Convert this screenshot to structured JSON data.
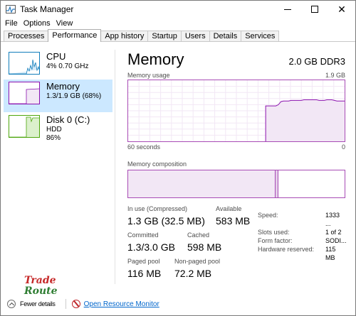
{
  "window": {
    "title": "Task Manager"
  },
  "menu": [
    "File",
    "Options",
    "View"
  ],
  "tabs": [
    "Processes",
    "Performance",
    "App history",
    "Startup",
    "Users",
    "Details",
    "Services"
  ],
  "active_tab": "Performance",
  "sidebar": [
    {
      "name": "CPU",
      "sub1": "4%  0.70 GHz",
      "sub2": "",
      "color": "#117dbb"
    },
    {
      "name": "Memory",
      "sub1": "1.3/1.9 GB (68%)",
      "sub2": "",
      "color": "#8b12ae"
    },
    {
      "name": "Disk 0 (C:)",
      "sub1": "HDD",
      "sub2": "86%",
      "color": "#4da60c"
    }
  ],
  "main": {
    "title": "Memory",
    "spec": "2.0 GB DDR3",
    "usage_label": "Memory usage",
    "usage_max": "1.9 GB",
    "x_left": "60 seconds",
    "x_right": "0",
    "composition_label": "Memory composition"
  },
  "stats": {
    "in_use_label": "In use (Compressed)",
    "in_use_value": "1.3 GB (32.5 MB)",
    "available_label": "Available",
    "available_value": "583 MB",
    "committed_label": "Committed",
    "committed_value": "1.3/3.0 GB",
    "cached_label": "Cached",
    "cached_value": "598 MB",
    "paged_label": "Paged pool",
    "paged_value": "116 MB",
    "nonpaged_label": "Non-paged pool",
    "nonpaged_value": "72.2 MB"
  },
  "properties": [
    {
      "label": "Speed:",
      "value": "1333 ..."
    },
    {
      "label": "Slots used:",
      "value": "1 of 2"
    },
    {
      "label": "Form factor:",
      "value": "SODI..."
    },
    {
      "label": "Hardware reserved:",
      "value": "115 MB"
    }
  ],
  "footer": {
    "fewer_details": "Fewer details",
    "resource_monitor": "Open Resource Monitor"
  },
  "watermark": {
    "line1": "Trade",
    "line2": "Route"
  },
  "usage_graph": {
    "values": [
      0,
      0,
      0,
      0,
      0,
      0,
      0,
      0,
      0,
      0,
      0,
      0,
      0,
      0,
      0,
      0,
      0,
      0,
      0,
      0,
      0,
      0,
      0,
      0,
      0,
      0,
      0,
      0,
      0,
      0,
      0,
      0,
      0,
      0,
      0,
      0,
      0,
      0,
      0,
      0,
      0,
      0,
      0,
      0,
      0,
      0,
      0,
      0,
      0,
      0,
      0,
      0,
      0,
      0,
      0.58,
      0.58,
      0.58,
      0.58,
      0.58,
      0.6,
      0.65,
      0.66,
      0.66,
      0.66,
      0.67,
      0.67,
      0.67,
      0.67,
      0.67,
      0.68,
      0.68,
      0.68,
      0.68,
      0.68,
      0.68,
      0.67,
      0.67,
      0.67,
      0.68,
      0.68,
      0.68,
      0.67,
      0.66,
      0.66,
      0.66,
      0.66
    ],
    "composition_in_use": 0.68,
    "composition_modified": 0.02
  }
}
